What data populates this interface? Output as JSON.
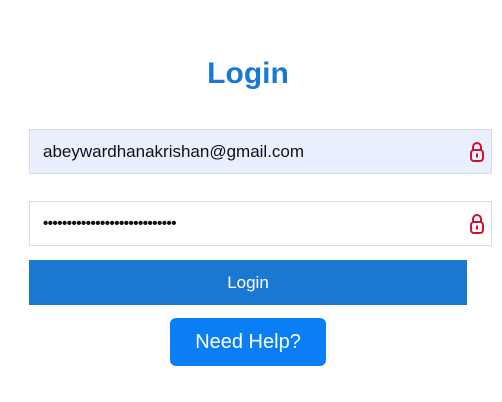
{
  "header": {
    "title": "Login"
  },
  "form": {
    "email": {
      "value": "abeywardhanakrishan@gmail.com",
      "icon": "lock-icon"
    },
    "password": {
      "value": "••••••••••••••••••••••••••••",
      "icon": "lock-icon"
    },
    "login_label": "Login",
    "help_label": "Need Help?"
  },
  "colors": {
    "title": "#1b78d2",
    "login_button": "#1b78d2",
    "help_button": "#0a7ef5",
    "email_field_bg": "#e8f0fe",
    "lock_icon": "#d0112b"
  }
}
